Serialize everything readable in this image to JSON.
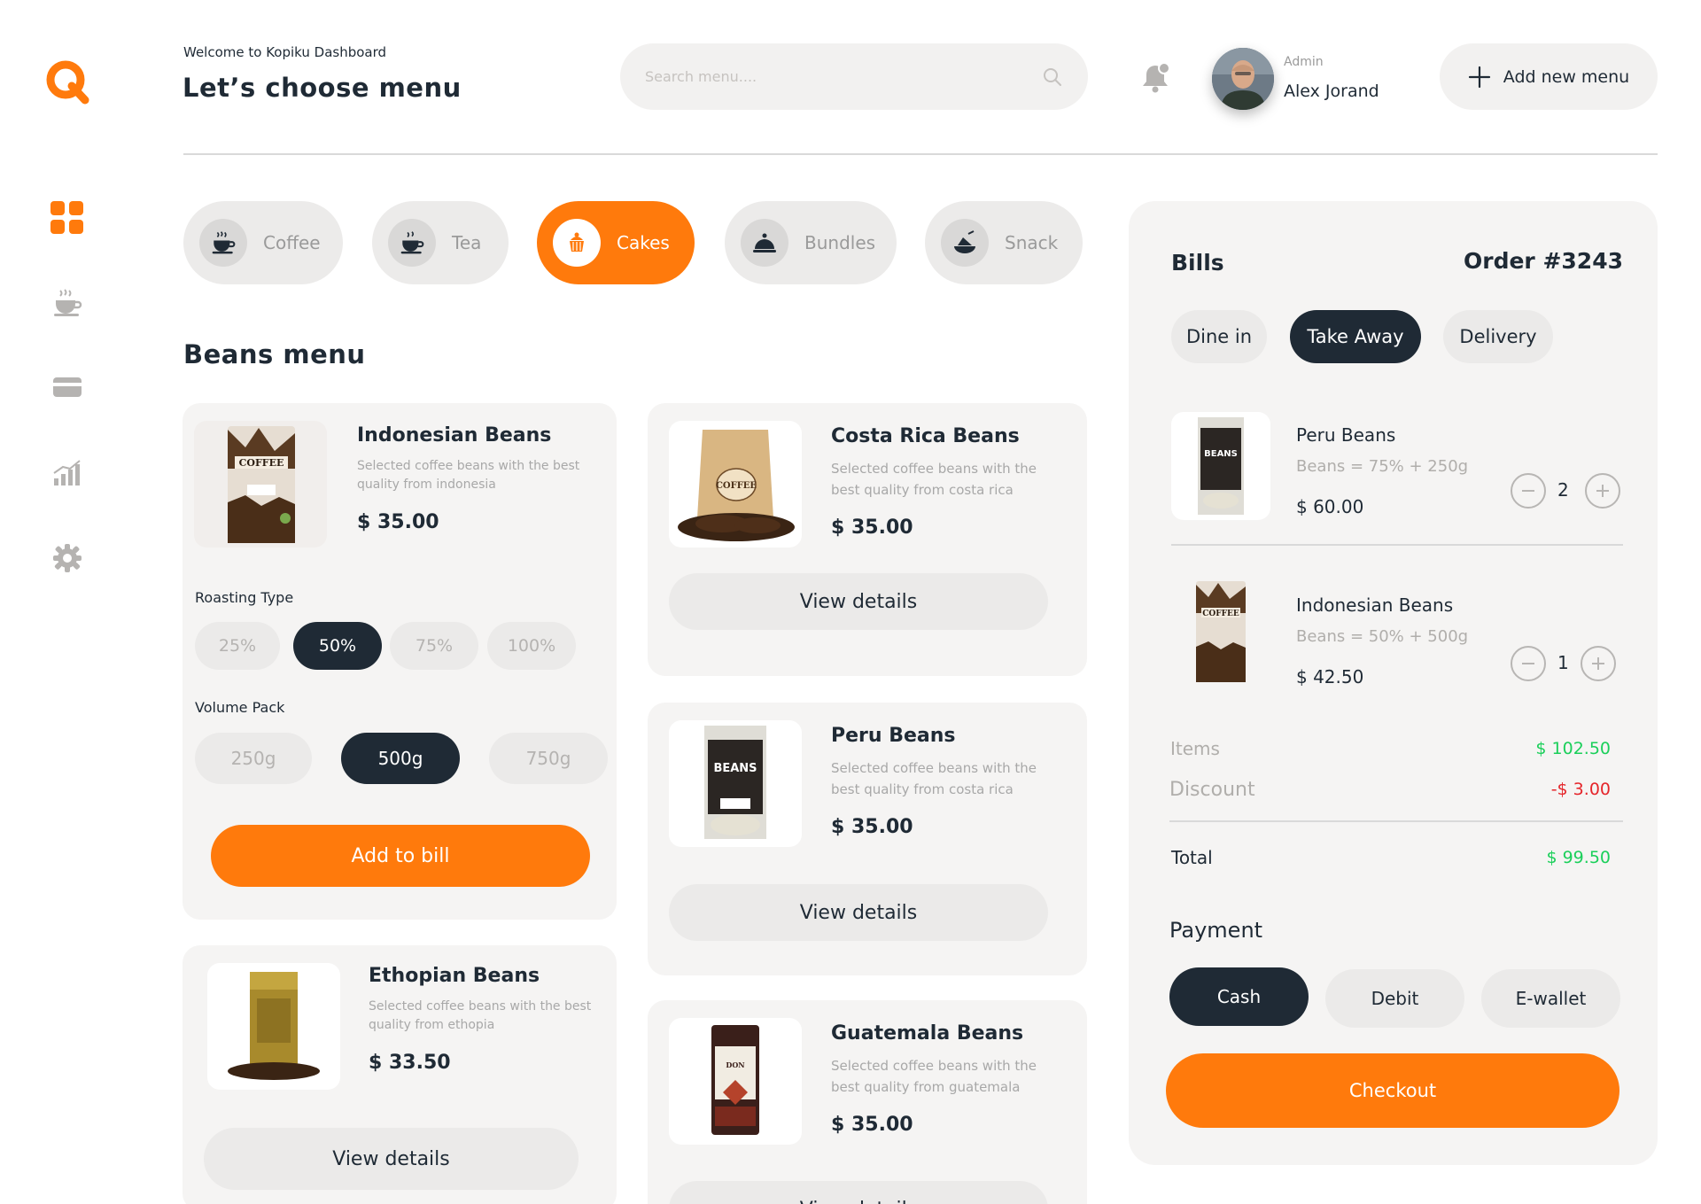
{
  "header": {
    "welcome": "Welcome to Kopiku Dashboard",
    "title": "Let’s choose menu",
    "search_placeholder": "Search menu....",
    "user_role": "Admin",
    "user_name": "Alex Jorand",
    "add_button": "Add new menu"
  },
  "sidebar": {
    "items": [
      {
        "icon": "dashboard-grid-icon",
        "active": true
      },
      {
        "icon": "coffee-cup-icon",
        "active": false
      },
      {
        "icon": "credit-card-icon",
        "active": false
      },
      {
        "icon": "analytics-chart-icon",
        "active": false
      },
      {
        "icon": "settings-gear-icon",
        "active": false
      }
    ]
  },
  "categories": [
    {
      "label": "Coffee",
      "icon": "coffee-cup-icon",
      "active": false
    },
    {
      "label": "Tea",
      "icon": "tea-cup-icon",
      "active": false
    },
    {
      "label": "Cakes",
      "icon": "cake-icon",
      "active": true
    },
    {
      "label": "Bundles",
      "icon": "food-cloche-icon",
      "active": false
    },
    {
      "label": "Snack",
      "icon": "snack-plate-icon",
      "active": false
    }
  ],
  "section_title": "Beans menu",
  "products": [
    {
      "name": "Indonesian Beans",
      "desc": "Selected coffee beans with the best quality from indonesia",
      "price": "$ 35.00"
    },
    {
      "name": "Costa Rica Beans",
      "desc": "Selected coffee beans with the best quality from costa rica",
      "price": "$ 35.00",
      "action": "View details"
    },
    {
      "name": "Peru Beans",
      "desc": "Selected coffee beans with the best quality from costa rica",
      "price": "$ 35.00",
      "action": "View details"
    },
    {
      "name": "Ethopian Beans",
      "desc": "Selected coffee beans with the best quality from ethopia",
      "price": "$ 33.50",
      "action": "View details"
    },
    {
      "name": "Guatemala Beans",
      "desc": "Selected coffee beans with the best quality from guatemala",
      "price": "$ 35.00",
      "action": "View details"
    }
  ],
  "options": {
    "roasting_label": "Roasting Type",
    "roasting": [
      "25%",
      "50%",
      "75%",
      "100%"
    ],
    "roasting_selected": "50%",
    "volume_label": "Volume Pack",
    "volume": [
      "250g",
      "500g",
      "750g"
    ],
    "volume_selected": "500g",
    "add_to_bill": "Add to bill"
  },
  "bills": {
    "title": "Bills",
    "order": "Order #3243",
    "order_types": [
      "Dine in",
      "Take Away",
      "Delivery"
    ],
    "order_type_selected": "Take Away",
    "items": [
      {
        "name": "Peru Beans",
        "detail": "Beans = 75% + 250g",
        "price": "$ 60.00",
        "qty": "2"
      },
      {
        "name": "Indonesian Beans",
        "detail": "Beans = 50% + 500g",
        "price": "$ 42.50",
        "qty": "1"
      }
    ],
    "items_label": "Items",
    "items_value": "$ 102.50",
    "discount_label": "Discount",
    "discount_value": "-$ 3.00",
    "total_label": "Total",
    "total_value": "$ 99.50",
    "payment_label": "Payment",
    "payment_methods": [
      "Cash",
      "Debit",
      "E-wallet"
    ],
    "payment_selected": "Cash",
    "checkout": "Checkout"
  },
  "colors": {
    "accent": "#ff7a0c",
    "dark": "#1f2a35",
    "green": "#1bcf5a",
    "red": "#e5252a"
  }
}
